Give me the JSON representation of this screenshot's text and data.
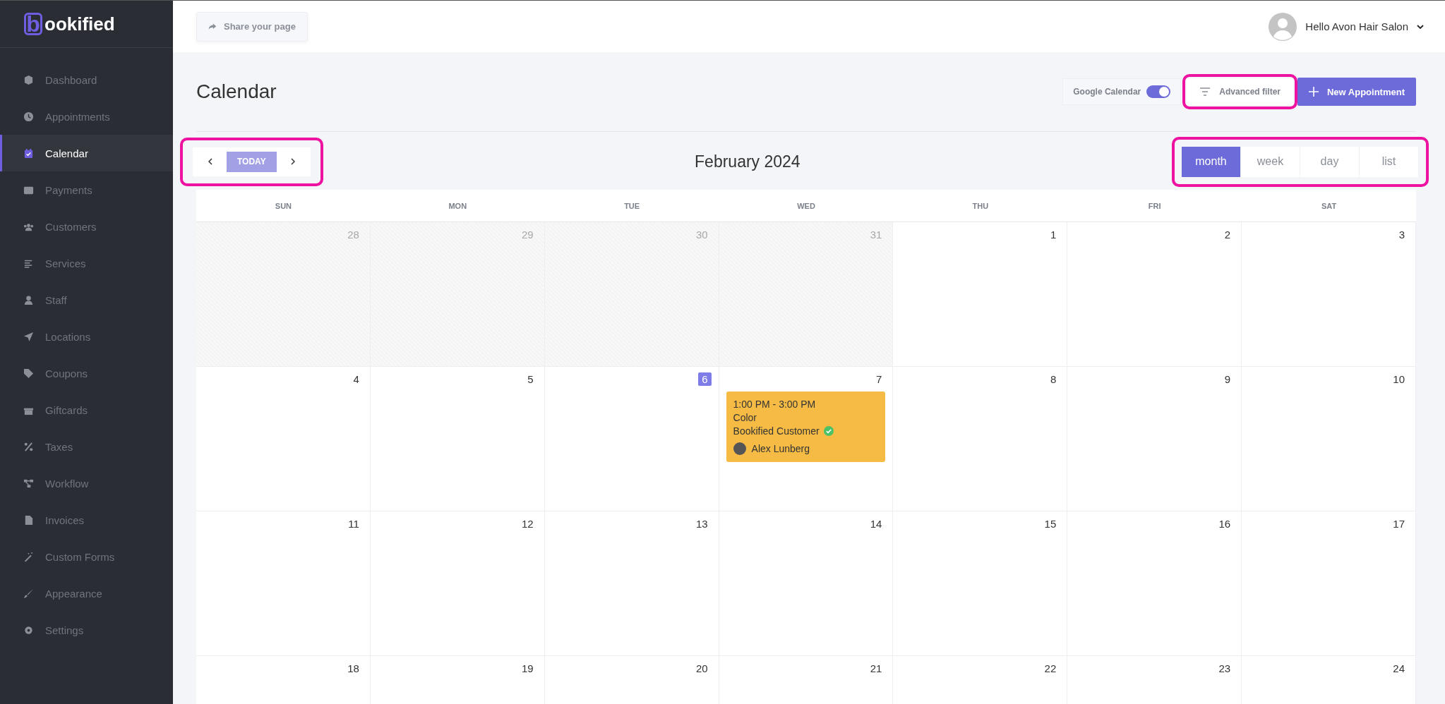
{
  "brand": {
    "logo_letter": "b",
    "name": "ookified"
  },
  "sidebar": {
    "items": [
      {
        "label": "Dashboard",
        "selected": false
      },
      {
        "label": "Appointments",
        "selected": false
      },
      {
        "label": "Calendar",
        "selected": true
      },
      {
        "label": "Payments",
        "selected": false
      },
      {
        "label": "Customers",
        "selected": false
      },
      {
        "label": "Services",
        "selected": false
      },
      {
        "label": "Staff",
        "selected": false
      },
      {
        "label": "Locations",
        "selected": false
      },
      {
        "label": "Coupons",
        "selected": false
      },
      {
        "label": "Giftcards",
        "selected": false
      },
      {
        "label": "Taxes",
        "selected": false
      },
      {
        "label": "Workflow",
        "selected": false
      },
      {
        "label": "Invoices",
        "selected": false
      },
      {
        "label": "Custom Forms",
        "selected": false
      },
      {
        "label": "Appearance",
        "selected": false
      },
      {
        "label": "Settings",
        "selected": false
      }
    ]
  },
  "topbar": {
    "share_button": "Share your page",
    "user_greeting": "Hello Avon Hair Salon"
  },
  "page_title": "Calendar",
  "google_calendar": {
    "label": "Google Calendar",
    "on": true
  },
  "advanced_filter": "Advanced filter",
  "new_appointment": "New Appointment",
  "nav": {
    "today": "TODAY"
  },
  "month_title": "February 2024",
  "views": [
    {
      "label": "month",
      "selected": true
    },
    {
      "label": "week",
      "selected": false
    },
    {
      "label": "day",
      "selected": false
    },
    {
      "label": "list",
      "selected": false
    }
  ],
  "weekdays": [
    "SUN",
    "MON",
    "TUE",
    "WED",
    "THU",
    "FRI",
    "SAT"
  ],
  "weeks": [
    [
      {
        "number": "28",
        "other_month": true,
        "today": false
      },
      {
        "number": "29",
        "other_month": true,
        "today": false
      },
      {
        "number": "30",
        "other_month": true,
        "today": false
      },
      {
        "number": "31",
        "other_month": true,
        "today": false
      },
      {
        "number": "1",
        "other_month": false,
        "today": false
      },
      {
        "number": "2",
        "other_month": false,
        "today": false
      },
      {
        "number": "3",
        "other_month": false,
        "today": false
      }
    ],
    [
      {
        "number": "4",
        "other_month": false,
        "today": false
      },
      {
        "number": "5",
        "other_month": false,
        "today": false
      },
      {
        "number": "6",
        "other_month": false,
        "today": true
      },
      {
        "number": "7",
        "other_month": false,
        "today": false,
        "events": [
          {
            "time": "1:00 PM - 3:00 PM",
            "service": "Color",
            "customer": "Bookified Customer",
            "confirmed": true,
            "staff": "Alex Lunberg",
            "color": "#f5bb45"
          }
        ]
      },
      {
        "number": "8",
        "other_month": false,
        "today": false
      },
      {
        "number": "9",
        "other_month": false,
        "today": false
      },
      {
        "number": "10",
        "other_month": false,
        "today": false
      }
    ],
    [
      {
        "number": "11",
        "other_month": false,
        "today": false
      },
      {
        "number": "12",
        "other_month": false,
        "today": false
      },
      {
        "number": "13",
        "other_month": false,
        "today": false
      },
      {
        "number": "14",
        "other_month": false,
        "today": false
      },
      {
        "number": "15",
        "other_month": false,
        "today": false
      },
      {
        "number": "16",
        "other_month": false,
        "today": false
      },
      {
        "number": "17",
        "other_month": false,
        "today": false
      }
    ],
    [
      {
        "number": "18",
        "other_month": false,
        "today": false
      },
      {
        "number": "19",
        "other_month": false,
        "today": false
      },
      {
        "number": "20",
        "other_month": false,
        "today": false
      },
      {
        "number": "21",
        "other_month": false,
        "today": false
      },
      {
        "number": "22",
        "other_month": false,
        "today": false
      },
      {
        "number": "23",
        "other_month": false,
        "today": false
      },
      {
        "number": "24",
        "other_month": false,
        "today": false
      }
    ]
  ]
}
